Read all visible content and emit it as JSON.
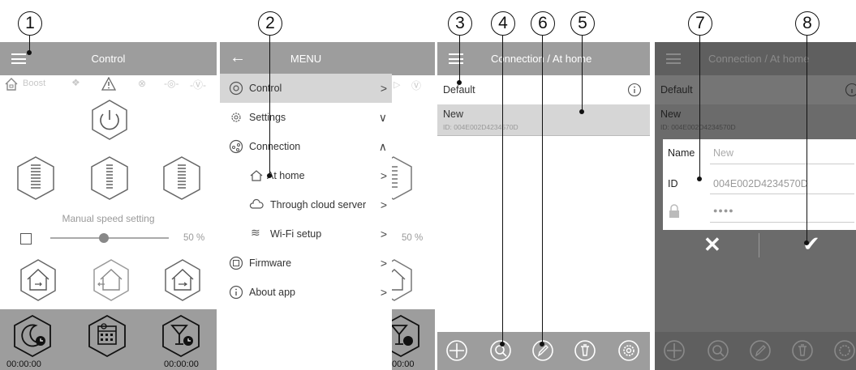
{
  "callouts": [
    "1",
    "2",
    "3",
    "4",
    "5",
    "6",
    "7",
    "8"
  ],
  "screen1": {
    "title": "Control",
    "strip_boost": "Boost",
    "manual_speed_label": "Manual speed setting",
    "slider_value": "50 %",
    "slider_fraction": 0.45,
    "timer_left": "00:00:00",
    "timer_right": "00:00:00"
  },
  "screen2": {
    "title": "MENU",
    "items": [
      {
        "label": "Control",
        "arrow": ">",
        "icon": "control-icon"
      },
      {
        "label": "Settings",
        "arrow": "∨",
        "icon": "settings-icon"
      },
      {
        "label": "Connection",
        "arrow": "∧",
        "icon": "connection-icon"
      },
      {
        "label": "At home",
        "arrow": ">",
        "icon": "home-icon"
      },
      {
        "label": "Through cloud server",
        "arrow": ">",
        "icon": "cloud-icon"
      },
      {
        "label": "Wi-Fi setup",
        "arrow": ">",
        "icon": "wifi-icon"
      },
      {
        "label": "Firmware",
        "arrow": ">",
        "icon": "firmware-icon"
      },
      {
        "label": "About app",
        "arrow": ">",
        "icon": "info-icon"
      }
    ],
    "behind_value": "50 %",
    "behind_timer": "00:00"
  },
  "screen3": {
    "title": "Connection / At home",
    "row1": "Default",
    "row2_name": "New",
    "row2_id": "ID: 004E002D4234570D"
  },
  "screen4": {
    "title": "Connection / At home",
    "row1": "Default",
    "row2_name": "New",
    "row2_id": "ID: 004E002D4234570D",
    "name_label": "Name",
    "name_value": "New",
    "id_label": "ID",
    "id_value": "004E002D4234570D",
    "password_mask": "●●●●"
  },
  "colors": {
    "appbar": "#9d9d9d",
    "selected": "#d6d6d6",
    "toolbar": "#9d9d9d",
    "dim": "#6b6b6b"
  }
}
